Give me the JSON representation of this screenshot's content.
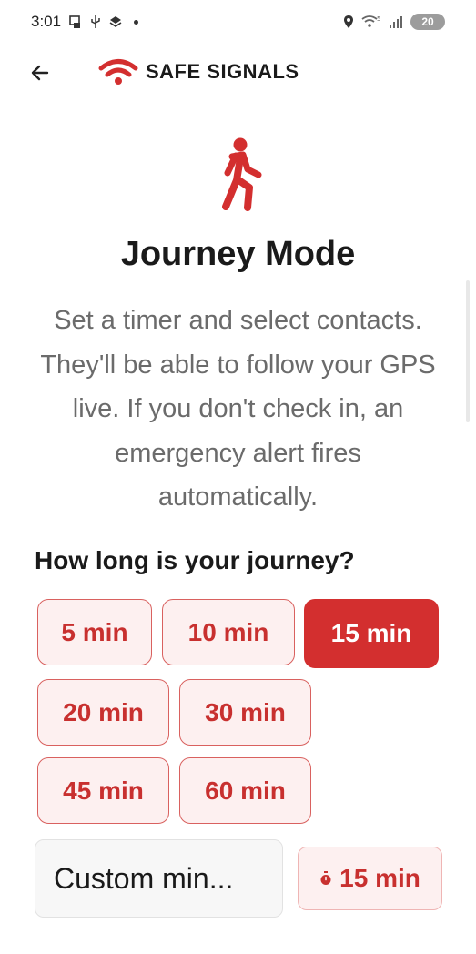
{
  "status_bar": {
    "time": "3:01",
    "battery": "20"
  },
  "app_bar": {
    "brand_name": "SAFE SIGNALS"
  },
  "hero": {
    "title": "Journey Mode",
    "description": "Set a timer and select contacts. They'll be able to follow your GPS live. If you don't check in, an emergency alert fires automatically."
  },
  "duration": {
    "question": "How long is your journey?",
    "options": [
      "5 min",
      "10 min",
      "15 min",
      "20 min",
      "30 min",
      "45 min",
      "60 min"
    ],
    "selected": "15 min",
    "custom_value": "Custom min...",
    "current_label": "15 min"
  },
  "colors": {
    "accent": "#d32f2f",
    "chip_bg": "#fdf0f0",
    "chip_border": "#d9615f",
    "muted_text": "#6b6b6b"
  },
  "icons": {
    "back": "arrow-left-icon",
    "brand": "wifi-signal-icon",
    "hero": "walking-person-icon",
    "timer": "stopwatch-icon"
  }
}
